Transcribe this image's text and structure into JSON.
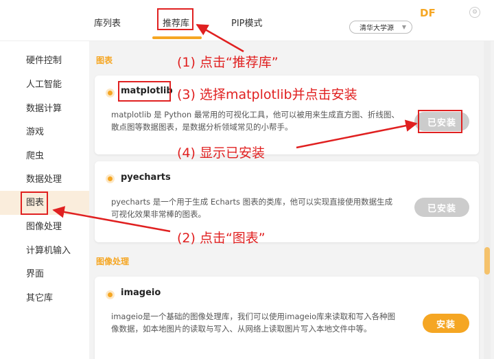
{
  "tabs": [
    {
      "label": "库列表"
    },
    {
      "label": "推荐库"
    },
    {
      "label": "PIP模式"
    }
  ],
  "source_select": {
    "value": "清华大学源"
  },
  "brand": "DF",
  "sidebar": {
    "items": [
      {
        "label": "硬件控制"
      },
      {
        "label": "人工智能"
      },
      {
        "label": "数据计算"
      },
      {
        "label": "游戏"
      },
      {
        "label": "爬虫"
      },
      {
        "label": "数据处理"
      },
      {
        "label": "图表"
      },
      {
        "label": "图像处理"
      },
      {
        "label": "计算机输入"
      },
      {
        "label": "界面"
      },
      {
        "label": "其它库"
      }
    ]
  },
  "sections": [
    {
      "title": "图表"
    },
    {
      "title": "图像处理"
    }
  ],
  "cards": [
    {
      "name": "matplotlib",
      "desc": "matplotlib 是 Python 最常用的可视化工具，他可以被用来生成直方图、折线图、散点图等数据图表，是数据分析领域常见的小帮手。",
      "button": "已安装"
    },
    {
      "name": "pyecharts",
      "desc": "pyecharts 是一个用于生成 Echarts 图表的类库，他可以实现直接使用数据生成可视化效果非常棒的图表。",
      "button": "已安装"
    },
    {
      "name": "imageio",
      "desc": "imageio是一个基础的图像处理库，我们可以使用imageio库来读取和写入各种图像数据，如本地图片的读取与写入、从网络上读取图片写入本地文件中等。",
      "button": "安装"
    }
  ],
  "annotations": [
    {
      "text": "(1) 点击“推荐库”"
    },
    {
      "text": "(2) 点击“图表”"
    },
    {
      "text": "(3) 选择matplotlib并点击安装"
    },
    {
      "text": "(4) 显示已安装"
    }
  ],
  "colors": {
    "accent": "#f5a623",
    "annotation": "#e02020",
    "installed_button": "#cccccc",
    "active_sidebar": "#faeddc"
  },
  "icons": [
    "settings-icon",
    "chevron-down-icon",
    "dot-icon"
  ]
}
